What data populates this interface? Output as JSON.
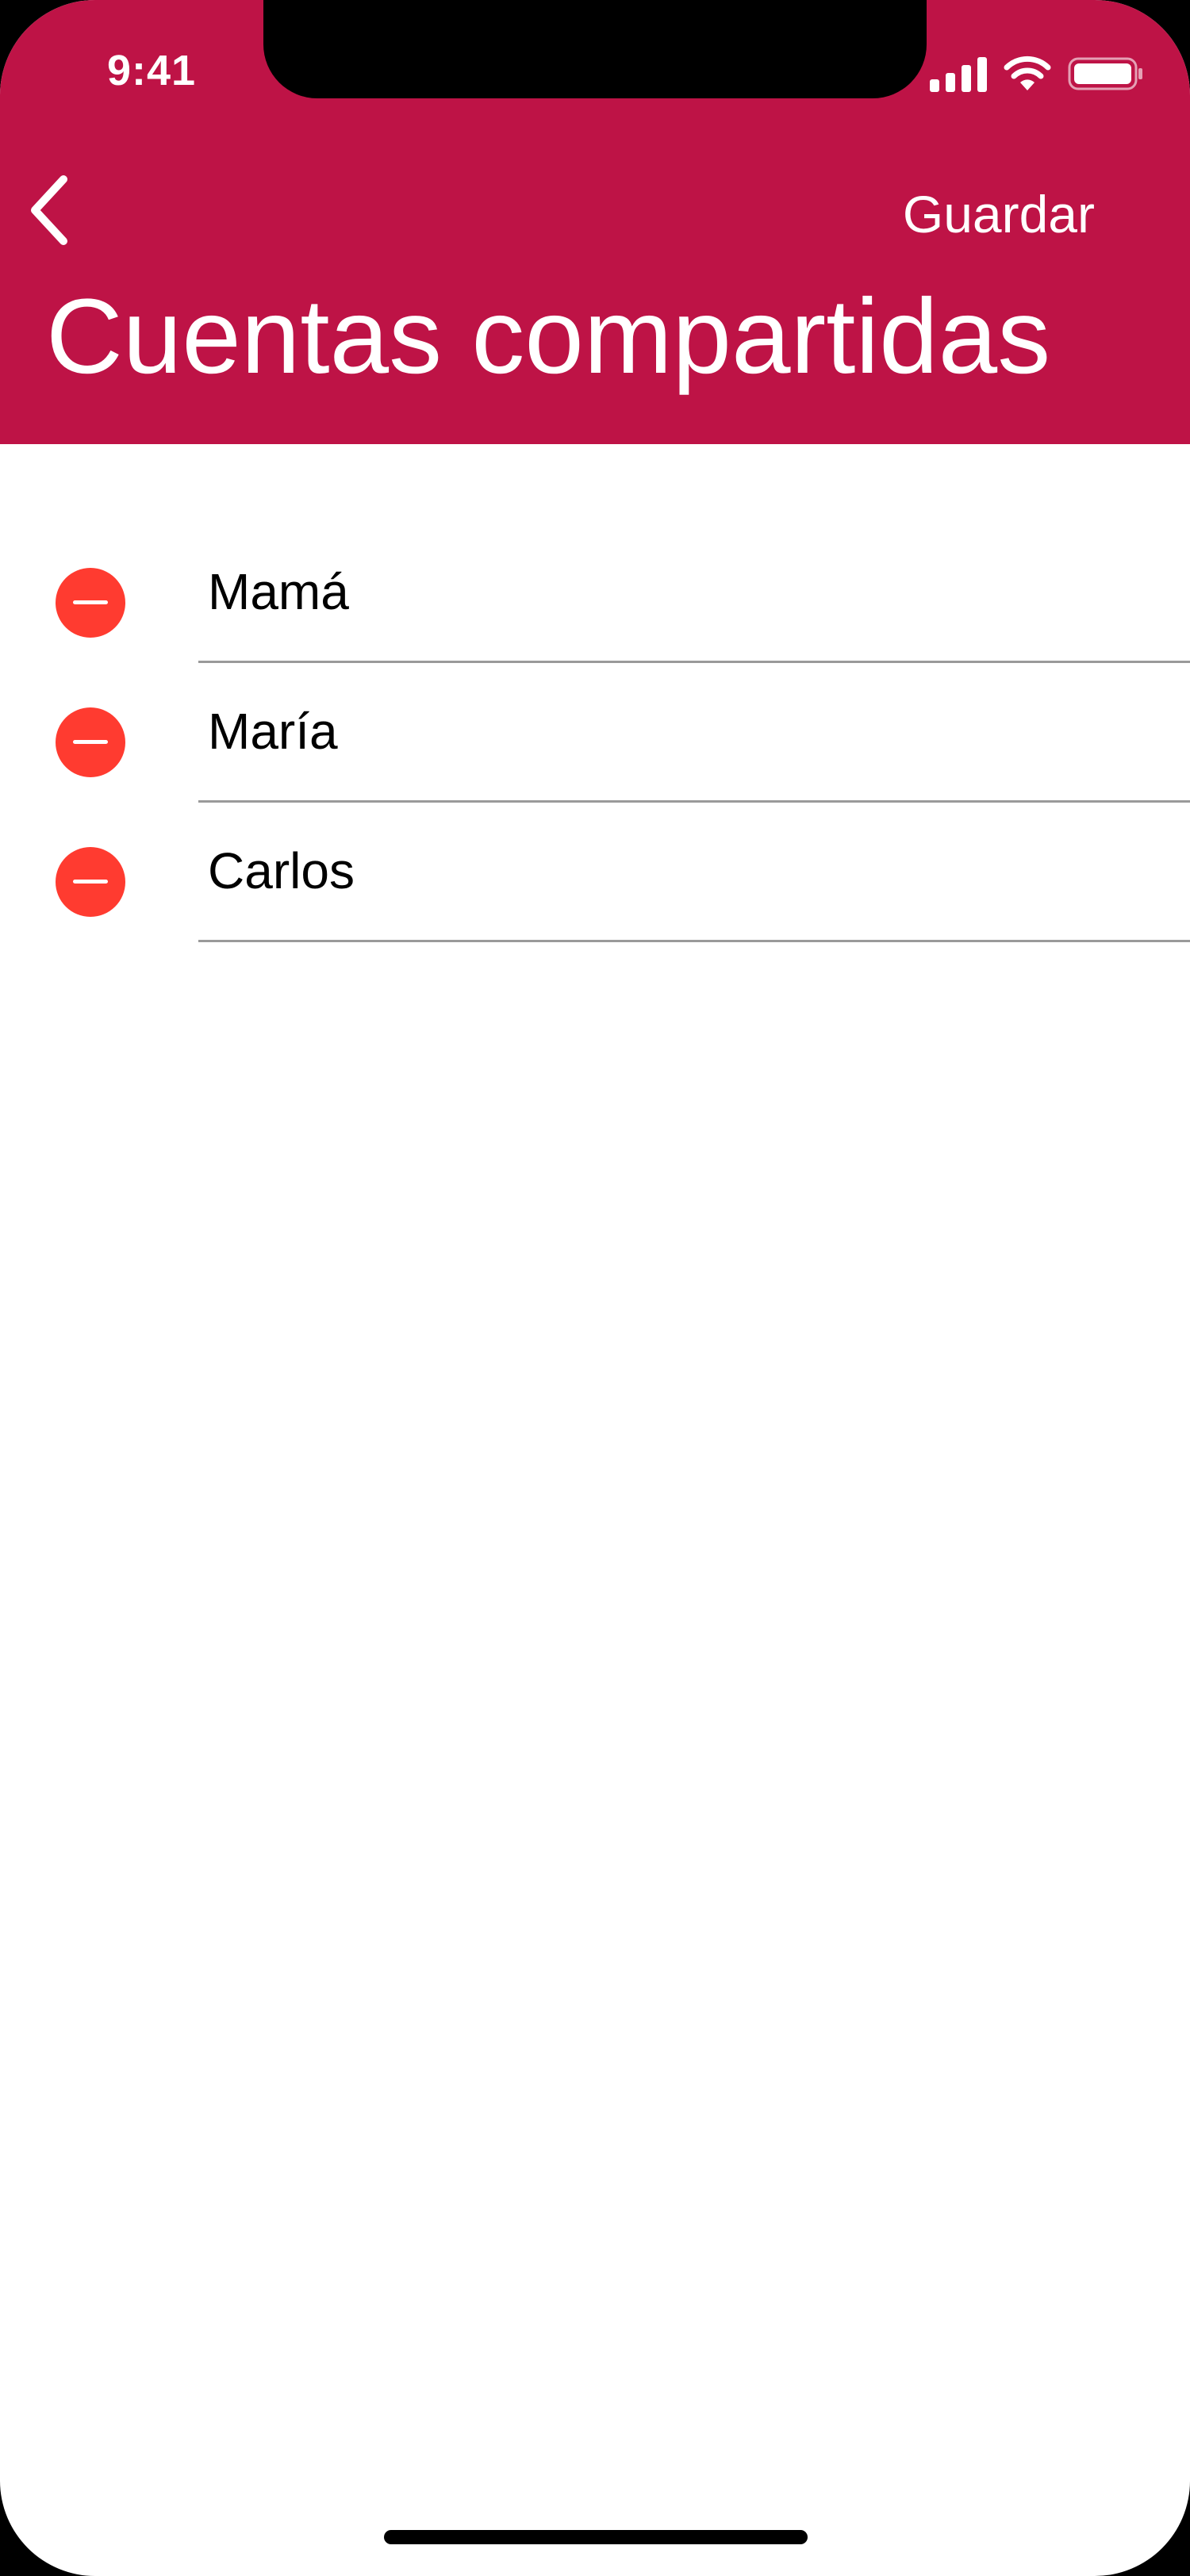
{
  "colors": {
    "header_background": "#be1346",
    "delete_red": "#ff3b30",
    "divider": "#9a9a9a",
    "text_on_header": "#ffffff"
  },
  "status_bar": {
    "time": "9:41",
    "icons": [
      "cellular-signal-icon",
      "wifi-icon",
      "battery-icon"
    ]
  },
  "nav": {
    "back_icon": "chevron-left-icon",
    "save_label": "Guardar",
    "title": "Cuentas compartidas"
  },
  "accounts": [
    {
      "name": "Mamá"
    },
    {
      "name": "María"
    },
    {
      "name": "Carlos"
    }
  ]
}
